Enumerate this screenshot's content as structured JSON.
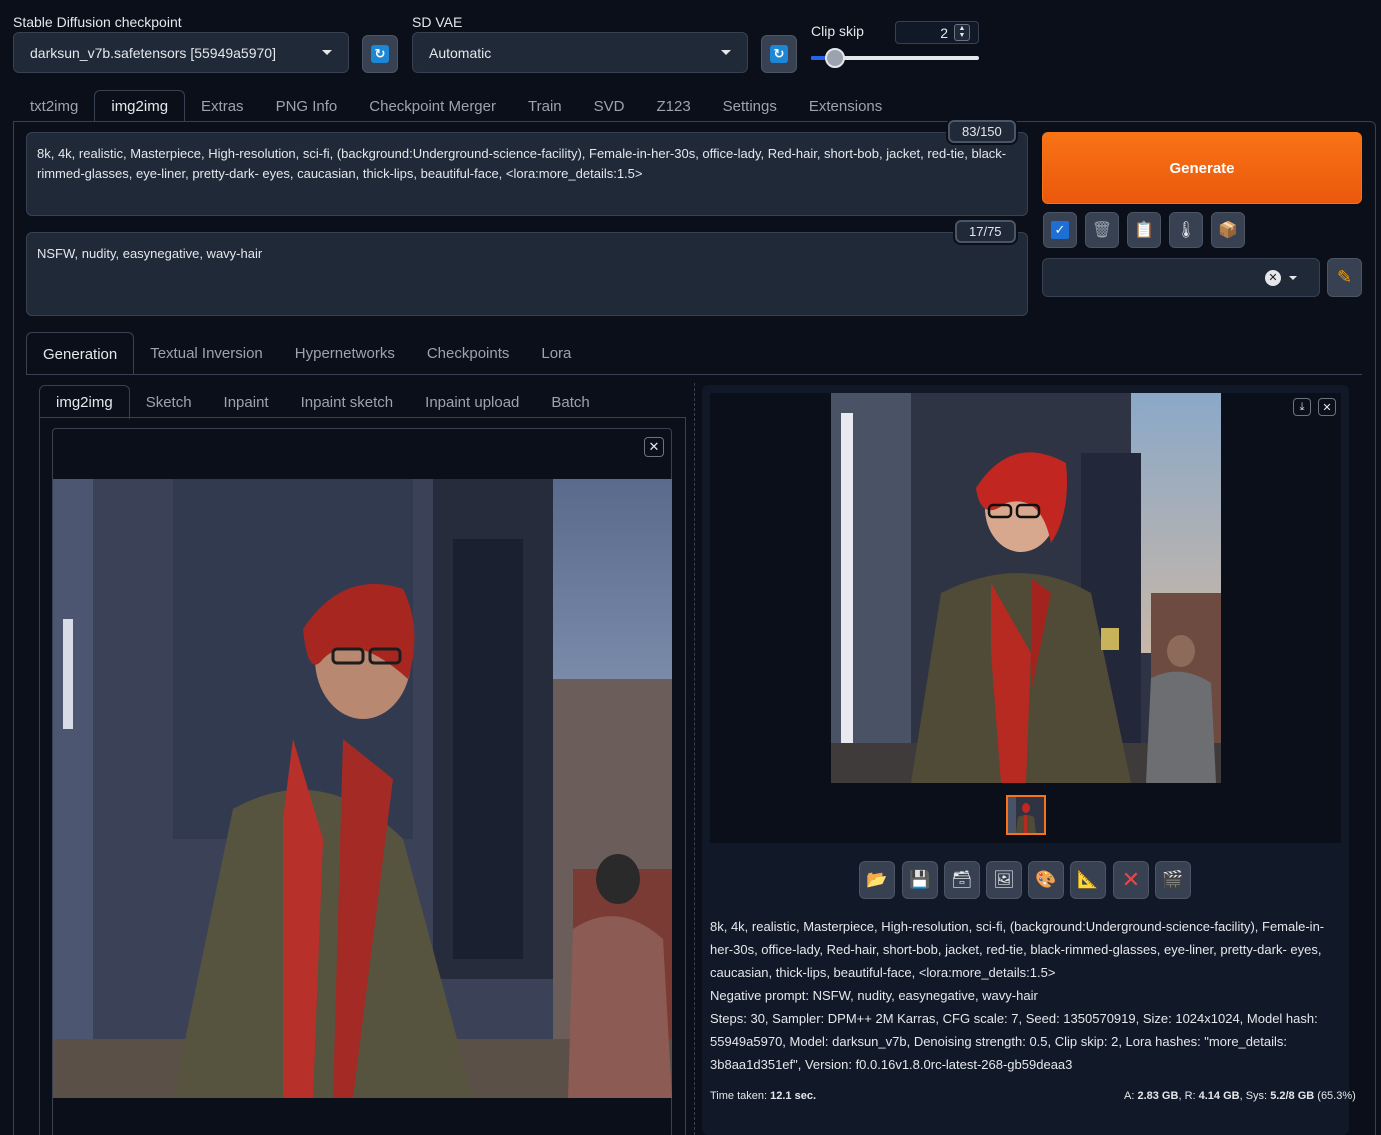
{
  "top": {
    "checkpoint_label": "Stable Diffusion checkpoint",
    "checkpoint_value": "darksun_v7b.safetensors [55949a5970]",
    "vae_label": "SD VAE",
    "vae_value": "Automatic",
    "clip_skip_label": "Clip skip",
    "clip_skip_value": "2",
    "clip_skip_level": 0.0
  },
  "tabs": [
    {
      "label": "txt2img"
    },
    {
      "label": "img2img"
    },
    {
      "label": "Extras"
    },
    {
      "label": "PNG Info"
    },
    {
      "label": "Checkpoint Merger"
    },
    {
      "label": "Train"
    },
    {
      "label": "SVD"
    },
    {
      "label": "Z123"
    },
    {
      "label": "Settings"
    },
    {
      "label": "Extensions"
    }
  ],
  "prompt": {
    "positive": "8k, 4k, realistic, Masterpiece, High-resolution, sci-fi, (background:Underground-science-facility), Female-in-her-30s, office-lady, Red-hair, short-bob, jacket, red-tie, black-rimmed-glasses, eye-liner, pretty-dark- eyes, caucasian, thick-lips, beautiful-face, <lora:more_details:1.5>",
    "positive_counter": "83/150",
    "negative": "NSFW, nudity,  easynegative, wavy-hair",
    "negative_counter": "17/75"
  },
  "generate_label": "Generate",
  "gen_tabs": [
    {
      "label": "Generation"
    },
    {
      "label": "Textual Inversion"
    },
    {
      "label": "Hypernetworks"
    },
    {
      "label": "Checkpoints"
    },
    {
      "label": "Lora"
    }
  ],
  "img_tabs": [
    {
      "label": "img2img"
    },
    {
      "label": "Sketch"
    },
    {
      "label": "Inpaint"
    },
    {
      "label": "Inpaint sketch"
    },
    {
      "label": "Inpaint upload"
    },
    {
      "label": "Batch"
    }
  ],
  "output": {
    "info_line1": "8k, 4k, realistic, Masterpiece, High-resolution, sci-fi, (background:Underground-science-facility), Female-in-",
    "info_line2": "her-30s, office-lady, Red-hair, short-bob, jacket, red-tie, black-rimmed-glasses, eye-liner, pretty-dark- eyes,",
    "info_line3": "caucasian, thick-lips, beautiful-face, <lora:more_details:1.5>",
    "info_line4": "Negative prompt: NSFW, nudity, easynegative, wavy-hair",
    "info_line5": "Steps: 30, Sampler: DPM++ 2M Karras, CFG scale: 7, Seed: 1350570919, Size: 1024x1024, Model hash:",
    "info_line6": "55949a5970, Model: darksun_v7b, Denoising strength: 0.5, Clip skip: 2, Lora hashes: \"more_details:",
    "info_line7": "3b8aa1d351ef\", Version: f0.0.16v1.8.0rc-latest-268-gb59deaa3",
    "time_label": "Time taken:",
    "time_value": "12.1 sec.",
    "vram_a_label": "A:",
    "vram_a_value": "2.83 GB",
    "vram_r_label": "R:",
    "vram_r_value": "4.14 GB",
    "vram_sys_label": "Sys:",
    "vram_sys_value": "5.2/8 GB",
    "vram_sys_pct": "(65.3%)"
  },
  "colors": {
    "background": "#0b0f19",
    "accent_orange": "#f97316",
    "accent_blue": "#1d87d6"
  }
}
